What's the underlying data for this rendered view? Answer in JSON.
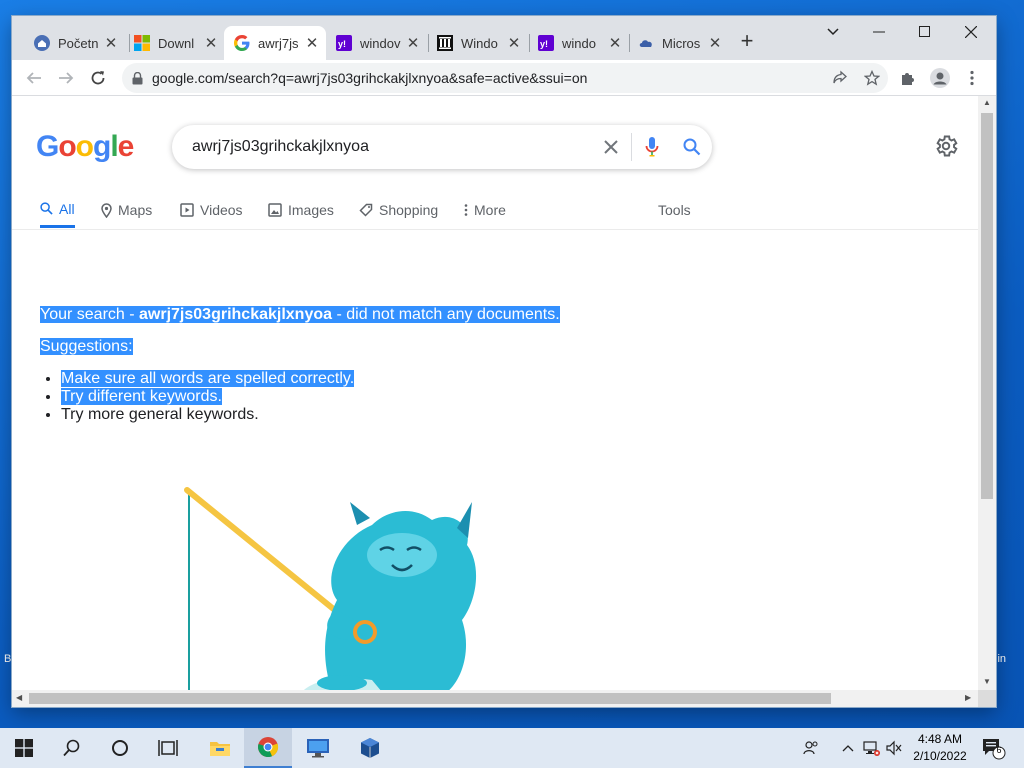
{
  "desktop": {
    "left_edge_text": "B",
    "right_edge_text": "in"
  },
  "tabs": [
    {
      "label": "Početn",
      "favicon": "home-circle-icon",
      "active": false
    },
    {
      "label": "Downl",
      "favicon": "microsoft-logo-icon",
      "active": false
    },
    {
      "label": "awrj7js",
      "favicon": "google-g-icon",
      "active": true
    },
    {
      "label": "windov",
      "favicon": "yahoo-icon",
      "active": false
    },
    {
      "label": "Windo",
      "favicon": "pillars-icon",
      "active": false
    },
    {
      "label": "windo",
      "favicon": "yahoo-icon",
      "active": false
    },
    {
      "label": "Micros",
      "favicon": "cloud-icon",
      "active": false
    }
  ],
  "omnibox": {
    "url": "google.com/search?q=awrj7js03grihckakjlxnyoa&safe=active&ssui=on"
  },
  "google": {
    "logo": [
      "G",
      "o",
      "o",
      "g",
      "l",
      "e"
    ],
    "logo_colors": [
      "#4285F4",
      "#EA4335",
      "#FBBC05",
      "#4285F4",
      "#34A853",
      "#EA4335"
    ],
    "query": "awrj7js03grihckakjlxnyoa",
    "search_tabs": {
      "all": "All",
      "maps": "Maps",
      "videos": "Videos",
      "images": "Images",
      "shopping": "Shopping",
      "more": "More",
      "tools": "Tools"
    }
  },
  "results": {
    "line_prefix": "Your search - ",
    "line_query": "awrj7js03grihckakjlxnyoa",
    "line_suffix": " - did not match any documents.",
    "suggestions_label": "Suggestions:",
    "suggestions": [
      "Make sure all words are spelled correctly.",
      "Try different keywords.",
      "Try more general keywords."
    ]
  },
  "taskbar": {
    "time": "4:48 AM",
    "date": "2/10/2022",
    "notification_count": "6"
  },
  "colors": {
    "accent": "#1a73e8",
    "selection": "#3390ff",
    "taskbar": "#dfe8f3",
    "tabstrip": "#dee1e6"
  }
}
